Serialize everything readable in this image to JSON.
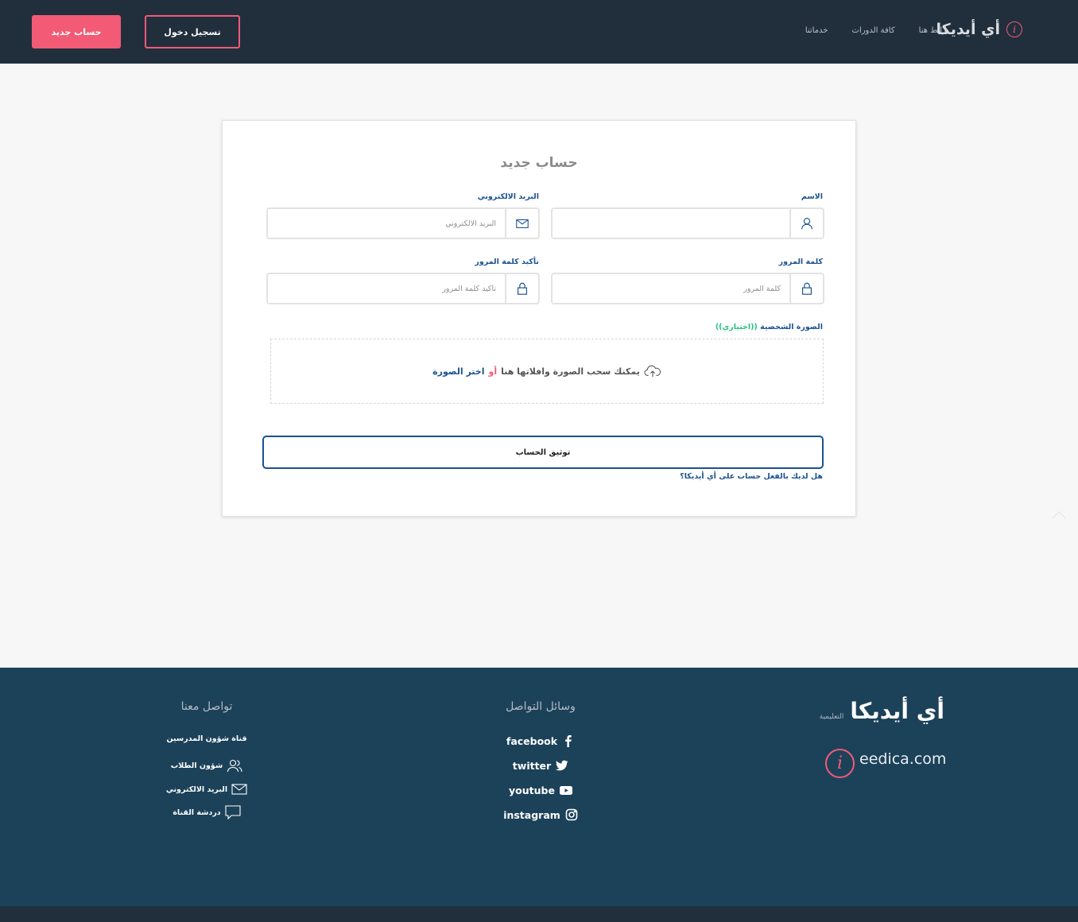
{
  "header": {
    "brand": "أي أيديكا",
    "nav": [
      "رابط هنا",
      "كافة الدورات",
      "خدماتنا"
    ],
    "login_label": "تسجيل دخول",
    "register_label": "حساب جديد"
  },
  "form": {
    "title": "حساب جديد",
    "name_label": "الاسم",
    "name_placeholder": "",
    "email_label": "البريد الالكتروني",
    "email_placeholder": "البريد الالكتروني",
    "password_label": "كلمة المرور",
    "password_placeholder": "كلمة المرور",
    "confirm_label": "تأكيد كلمة المرور",
    "confirm_placeholder": "تأكيد كلمة المرور",
    "photo_label": "الصورة الشخصية",
    "photo_optional": "((اختياري))",
    "dropzone_text": "يمكنك سحب الصورة وافلاتها هنا",
    "dropzone_or": "أو",
    "dropzone_pick": "اختر الصورة",
    "submit_label": "توثيق الحساب",
    "has_account_link": "هل لديك بالفعل حساب على أي أيديكا؟"
  },
  "footer": {
    "brand": "أي أيديكا",
    "brand_sub": "التعليمية",
    "domain": "eedica.com",
    "social_heading": "وسائل التواصل",
    "social": [
      "facebook",
      "twitter",
      "youtube",
      "instagram"
    ],
    "contact_heading": "تواصل معنا",
    "contact": [
      "قناة شؤون المدرسين",
      "شؤون الطلاب",
      "البريد الالكتروني",
      "دردشة القناة"
    ]
  },
  "colors": {
    "header_bg": "#212f3d",
    "accent_pink": "#f25a75",
    "label_blue": "#1a5290",
    "footer_bg": "#1c425a",
    "optional_green": "#27c083"
  }
}
